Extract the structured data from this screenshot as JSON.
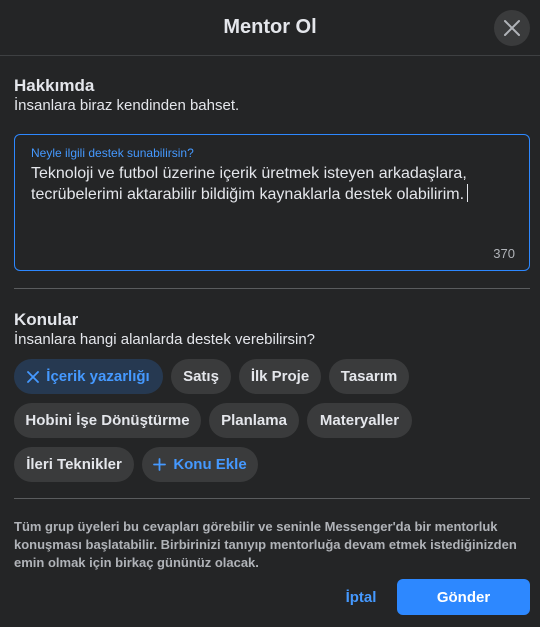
{
  "header": {
    "title": "Mentor Ol",
    "close_icon": "close-icon"
  },
  "about": {
    "title": "Hakkımda",
    "subtitle": "İnsanlara biraz kendinden bahset.",
    "field_label": "Neyle ilgili destek sunabilirsin?",
    "field_value": "Teknoloji ve futbol üzerine içerik üretmek isteyen arkadaşlara, tecrübelerimi aktarabilir bildiğim kaynaklarla destek olabilirim.",
    "char_count": "370"
  },
  "topics": {
    "title": "Konular",
    "subtitle": "İnsanlara hangi alanlarda destek verebilirsin?",
    "chips": [
      {
        "label": "İçerik yazarlığı",
        "selected": true,
        "icon": "x-icon"
      },
      {
        "label": "Satış",
        "selected": false
      },
      {
        "label": "İlk Proje",
        "selected": false
      },
      {
        "label": "Tasarım",
        "selected": false
      },
      {
        "label": "Hobini İşe Dönüştürme",
        "selected": false
      },
      {
        "label": "Planlama",
        "selected": false
      },
      {
        "label": "Materyaller",
        "selected": false
      },
      {
        "label": "İleri Teknikler",
        "selected": false
      }
    ],
    "add_label": "Konu Ekle",
    "add_icon": "plus-icon"
  },
  "footer": {
    "note": "Tüm grup üyeleri bu cevapları görebilir ve seninle Messenger'da bir mentorluk konuşması başlatabilir. Birbirinizi tanıyıp mentorluğa devam etmek istediğinizden emin olmak için birkaç gününüz olacak.",
    "cancel_label": "İptal",
    "send_label": "Gönder"
  },
  "colors": {
    "accent": "#2d88ff",
    "background": "#242526",
    "chip": "#3a3b3c",
    "selected_chip": "#263951"
  }
}
